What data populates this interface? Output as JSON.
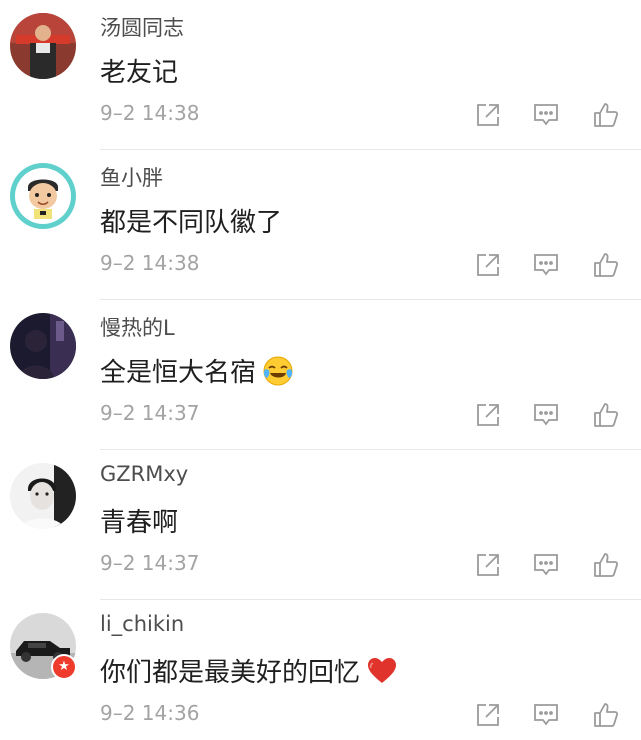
{
  "comments": [
    {
      "username": "汤圆同志",
      "text": "老友记",
      "time": "9–2 14:38",
      "avatar": "avatar-man-red-scarf",
      "emoji": ""
    },
    {
      "username": "鱼小胖",
      "text": "都是不同队徽了",
      "time": "9–2 14:38",
      "avatar": "avatar-cartoon-boy",
      "emoji": ""
    },
    {
      "username": "慢热的L",
      "text": "全是恒大名宿",
      "time": "9–2 14:37",
      "avatar": "avatar-dark-silhouette",
      "emoji": "crying-laughing-emoji"
    },
    {
      "username": "GZRMxy",
      "text": "青春啊",
      "time": "9–2 14:37",
      "avatar": "avatar-bw-portrait",
      "emoji": ""
    },
    {
      "username": "li_chikin",
      "text": "你们都是最美好的回忆",
      "time": "9–2 14:36",
      "avatar": "avatar-car-model",
      "emoji": "red-heart-emoji"
    }
  ],
  "icons": {
    "share": "share-icon",
    "reply": "comment-icon",
    "like": "thumbs-up-icon"
  },
  "colors": {
    "username": "#4d4d4d",
    "text": "#1f1f1f",
    "timestamp": "#a3a3a3",
    "icon": "#9b9b9b",
    "divider": "#e8e8e8",
    "heart": "#e0332b",
    "badge": "#ee3b2b"
  }
}
